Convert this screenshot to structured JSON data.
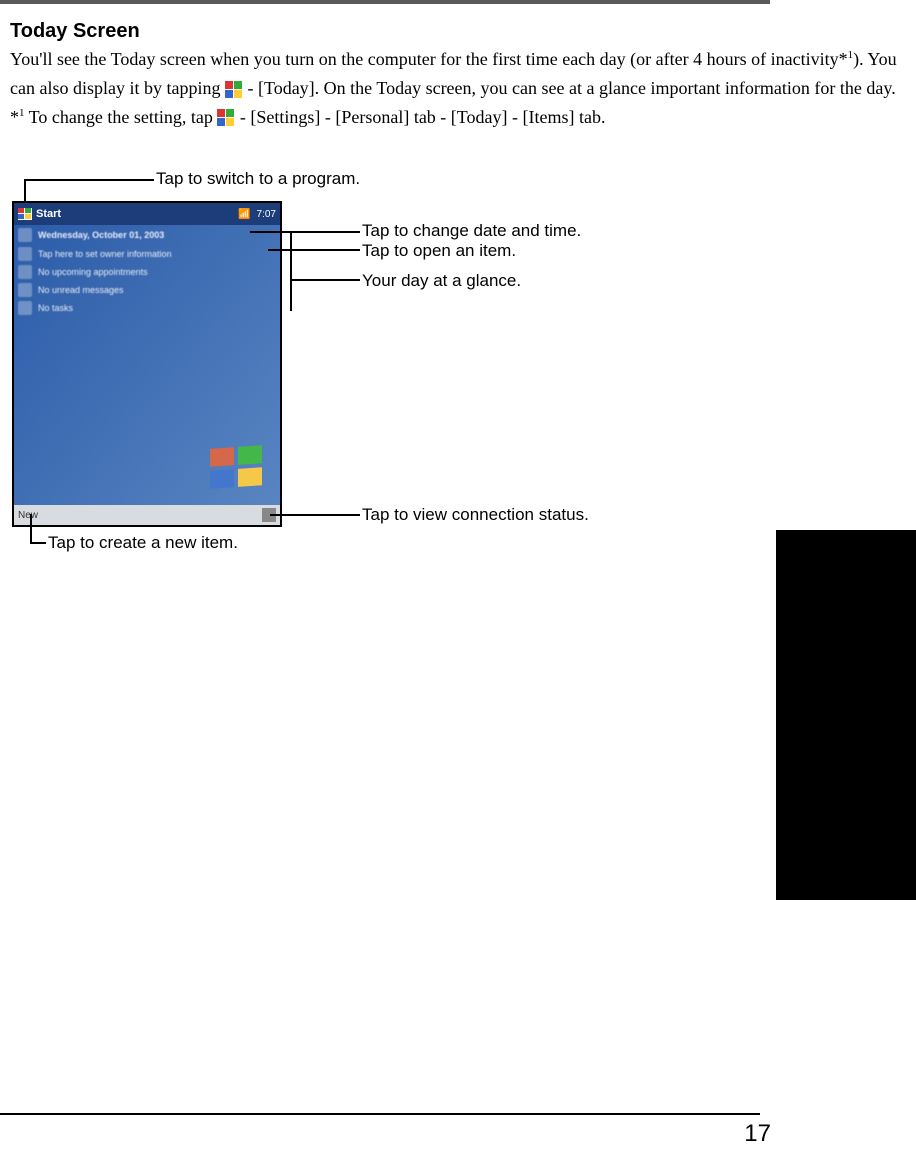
{
  "heading": "Today Screen",
  "p1a": "You'll see the Today screen when you turn on the computer for the first time each day (or after 4 hours of inactivity*",
  "p1sup": "1",
  "p1b": "). You can also display it by tapping ",
  "p1c": " - [Today]. On the Today screen, you can see at a glance important information for the day.",
  "note_pre": "*",
  "note_sup": "1",
  "note_a": "  To change the setting, tap ",
  "note_b": " - [Settings] - [Personal] tab - [Today] - [Items] tab.",
  "callouts": {
    "switch": "Tap to switch to a program.",
    "date": "Tap to change date and time.",
    "open": "Tap to open an item.",
    "glance": "Your day at a glance.",
    "conn": "Tap to view connection status.",
    "new": "Tap to create a new item."
  },
  "screenshot": {
    "title": "Start",
    "time": "7:07",
    "date_row": "Wednesday, October 01, 2003",
    "owner_row": "Tap here to set owner information",
    "appt_row": "No upcoming appointments",
    "msg_row": "No unread messages",
    "task_row": "No tasks",
    "new_label": "New"
  },
  "page_number": "17"
}
